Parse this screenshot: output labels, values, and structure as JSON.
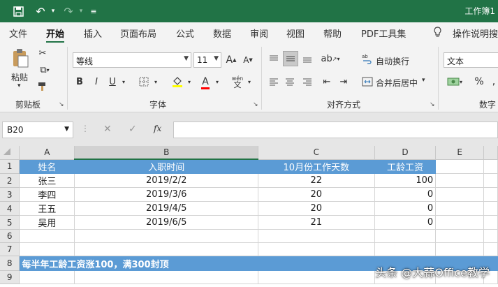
{
  "titlebar": {
    "title": "工作簿1",
    "icons": [
      "save-icon",
      "undo-icon",
      "redo-icon",
      "customize-qat-icon"
    ]
  },
  "menu": {
    "tabs": [
      "文件",
      "开始",
      "插入",
      "页面布局",
      "公式",
      "数据",
      "审阅",
      "视图",
      "帮助",
      "PDF工具集"
    ],
    "active": "开始",
    "tell_me": "操作说明搜"
  },
  "ribbon": {
    "clipboard": {
      "paste": "粘贴",
      "label": "剪贴板"
    },
    "font": {
      "name": "等线",
      "size": "11",
      "label": "字体",
      "phonetic": "wén"
    },
    "alignment": {
      "wrap": "自动换行",
      "merge": "合并后居中",
      "label": "对齐方式"
    },
    "number": {
      "format": "文本",
      "label": "数字"
    }
  },
  "formula_bar": {
    "name_box": "B20",
    "fx": "fx",
    "value": ""
  },
  "sheet": {
    "columns": [
      "A",
      "B",
      "C",
      "D",
      "E"
    ],
    "rows": [
      "1",
      "2",
      "3",
      "4",
      "5",
      "6",
      "7",
      "8",
      "9"
    ],
    "header": [
      "姓名",
      "入职时间",
      "10月份工作天数",
      "工龄工资"
    ],
    "data": [
      [
        "张三",
        "2019/2/2",
        "22",
        "100"
      ],
      [
        "李四",
        "2019/3/6",
        "20",
        "0"
      ],
      [
        "王五",
        "2019/4/5",
        "20",
        "0"
      ],
      [
        "吴用",
        "2019/6/5",
        "21",
        "0"
      ]
    ],
    "note": "每半年工龄工资涨100，满300封顶",
    "colors": {
      "header_fill": "#5b9bd5",
      "brand": "#217346"
    }
  },
  "watermark": "头条 @大蒜Office教学"
}
